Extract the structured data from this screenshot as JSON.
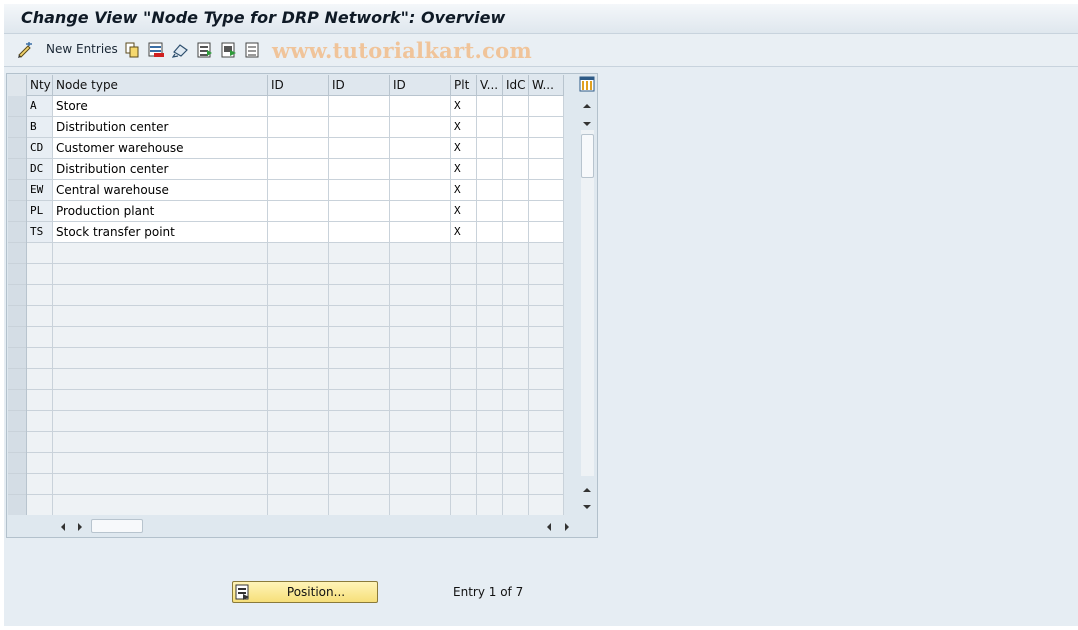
{
  "window": {
    "title": "Change View \"Node Type for DRP Network\": Overview"
  },
  "toolbar": {
    "new_entries_label": "New Entries",
    "watermark": "www.tutorialkart.com"
  },
  "table": {
    "columns": [
      "Nty",
      "Node type",
      "ID",
      "ID",
      "ID",
      "Plt",
      "V...",
      "IdC",
      "W..."
    ],
    "rows": [
      {
        "nty": "A",
        "node_type": "Store",
        "plt": "X"
      },
      {
        "nty": "B",
        "node_type": "Distribution center",
        "plt": "X"
      },
      {
        "nty": "CD",
        "node_type": "Customer warehouse",
        "plt": "X"
      },
      {
        "nty": "DC",
        "node_type": "Distribution center",
        "plt": "X"
      },
      {
        "nty": "EW",
        "node_type": "Central warehouse",
        "plt": "X"
      },
      {
        "nty": "PL",
        "node_type": "Production plant",
        "plt": "X"
      },
      {
        "nty": "TS",
        "node_type": "Stock transfer point",
        "plt": "X"
      }
    ]
  },
  "footer": {
    "position_label": "Position...",
    "entry_info": "Entry 1 of 7"
  },
  "icons": {
    "toolbar": [
      "pencil-icon",
      "copy-icon",
      "delete-icon",
      "undo-icon",
      "select-all-icon",
      "select-block-icon",
      "deselect-all-icon"
    ],
    "table": [
      "column-settings-icon"
    ],
    "footer": [
      "position-icon"
    ]
  },
  "colors": {
    "watermark": "#f0c49a",
    "position_button": "#f6df7a",
    "title_bar": "#dfe7ee"
  }
}
